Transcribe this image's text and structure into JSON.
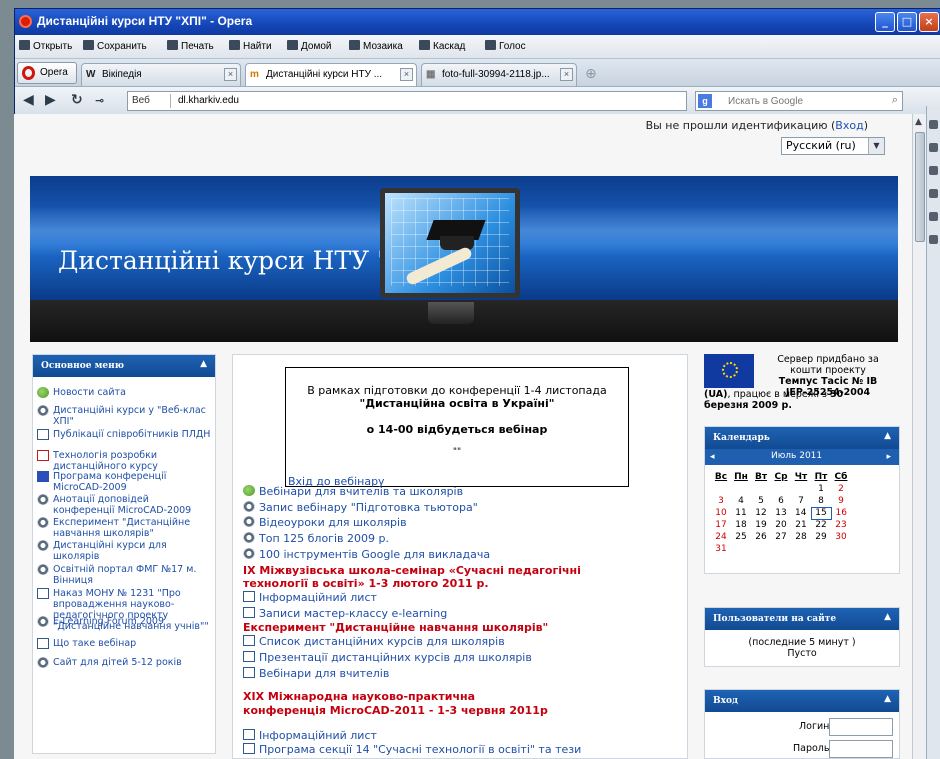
{
  "window": {
    "title": "Дистанційні курси НТУ \"ХПІ\" - Opera"
  },
  "menubar": [
    {
      "label": "Открыть"
    },
    {
      "label": "Сохранить"
    },
    {
      "label": "Печать"
    },
    {
      "label": "Найти"
    },
    {
      "label": "Домой"
    },
    {
      "label": "Мозаика"
    },
    {
      "label": "Каскад"
    },
    {
      "label": "Голос"
    }
  ],
  "tabs": {
    "opera_button": "Opera",
    "items": [
      {
        "label": "Вікіпедія"
      },
      {
        "label": "Дистанційні курси НТУ ..."
      },
      {
        "label": "foto-full-30994-2118.jp..."
      }
    ]
  },
  "navbar": {
    "web_label": "Веб",
    "url": "dl.kharkiv.edu",
    "search_placeholder": "Искать в Google"
  },
  "page": {
    "login_status": "Вы не прошли идентификацию (",
    "login_link": "Вход",
    "login_close": ")",
    "language": "Русский (ru)",
    "banner_title": "Дистанційні курси НТУ \"ХПІ\""
  },
  "left_menu": {
    "title": "Основное меню",
    "items": [
      {
        "label": "Новости сайта",
        "icon": "news-icon"
      },
      {
        "label": "Дистанційні курси у \"Веб-клас ХПІ\"",
        "icon": "moodle-icon"
      },
      {
        "label": "Публікації співробітників ПЛДН",
        "icon": "page-icon"
      },
      {
        "label": "Технологія розробки дистанційного курсу",
        "icon": "pdf-icon"
      },
      {
        "label": "Програма конференції MicroCAD-2009",
        "icon": "word-icon"
      },
      {
        "label": "Анотації доповідей конференції MicroCAD-2009",
        "icon": "moodle-icon"
      },
      {
        "label": "Експеримент \"Дистанційне навчання школярів\"",
        "icon": "moodle-icon"
      },
      {
        "label": "Дистанційні курси для школярів",
        "icon": "moodle-icon"
      },
      {
        "label": "Освітній портал ФМГ №17 м. Вінниця",
        "icon": "moodle-icon"
      },
      {
        "label": "Наказ МОНУ № 1231 \"Про впровадження науково-педагогічного проекту \"Дистанційне навчання учнів\"\"",
        "icon": "page-icon"
      },
      {
        "label": "E-Learning Forum 2009",
        "icon": "moodle-icon"
      },
      {
        "label": "Що таке вебінар",
        "icon": "page-icon"
      },
      {
        "label": "Сайт для дітей 5-12 років",
        "icon": "moodle-icon"
      }
    ]
  },
  "center": {
    "notice": {
      "line1": "В рамках підготовки до конференції 1-4 листопада",
      "line2": "\"Дистанційна освіта в Україні\"",
      "line3": "о 14-00 відбудеться вебінар",
      "line4": "\"\"",
      "link": "Вхід до вебінару"
    },
    "links1": [
      {
        "label": "Вебінари для вчителів та школярів",
        "icon": "news-icon"
      },
      {
        "label": "Запис вебінару \"Підготовка тьютора\"",
        "icon": "moodle-icon"
      },
      {
        "label": "Відеоуроки для школярів",
        "icon": "moodle-icon"
      },
      {
        "label": "Топ 125 блогів 2009 р.",
        "icon": "moodle-icon"
      },
      {
        "label": "100 інструментів Google для викладача",
        "icon": "moodle-icon"
      }
    ],
    "heading1_line1": "IX Міжвузівська школа-семінар «Сучасні педагогічні",
    "heading1_line2": "технології в освіті» 1-3 лютого 2011 р.",
    "links2": [
      {
        "label": "Інформаційний лист"
      },
      {
        "label": "Записи мастер-классу e-learning"
      }
    ],
    "heading2": "Експеримент \"Дистанційне навчання школярів\"",
    "links3": [
      {
        "label": "Список дистанційних курсів для школярів"
      },
      {
        "label": "Презентації дистанційних курсів для школярів"
      },
      {
        "label": "Вебінари для вчителів"
      }
    ],
    "heading3_line1": "XIX Міжнародна науково-практична",
    "heading3_line2": "конференція MicroCAD-2011 - 1-3 червня 2011р",
    "links4": [
      {
        "label": "Інформаційний лист"
      },
      {
        "label": "Програма секції 14 \"Сучасні технології в освіті\" та тези"
      }
    ]
  },
  "right": {
    "eu_text_l1": "Сервер придбано за",
    "eu_text_l2": "кошти проекту",
    "eu_text_l3": "Темпус Тасіс № IB",
    "eu_text_l4": "JEP-25254-2004",
    "eu_text_l5_a": "(UA)",
    "eu_text_l5_b": ", працює в мережі з ",
    "eu_text_l5_c": "30",
    "eu_text_l6": "березня 2009 р.",
    "calendar": {
      "title": "Календарь",
      "month": "Июль 2011",
      "prev": "◂",
      "next": "▸",
      "days": [
        "Вс",
        "Пн",
        "Вт",
        "Ср",
        "Чт",
        "Пт",
        "Сб"
      ],
      "weeks": [
        [
          "",
          "",
          "",
          "",
          "",
          "1",
          "2"
        ],
        [
          "3",
          "4",
          "5",
          "6",
          "7",
          "8",
          "9"
        ],
        [
          "10",
          "11",
          "12",
          "13",
          "14",
          "15",
          "16"
        ],
        [
          "17",
          "18",
          "19",
          "20",
          "21",
          "22",
          "23"
        ],
        [
          "24",
          "25",
          "26",
          "27",
          "28",
          "29",
          "30"
        ],
        [
          "31",
          "",
          "",
          "",
          "",
          "",
          ""
        ]
      ],
      "today": "15"
    },
    "users": {
      "title": "Пользователи на сайте",
      "line1": "(последние 5 минут )",
      "line2": "Пусто"
    },
    "login": {
      "title": "Вход",
      "username_label": "Логин",
      "password_label": "Пароль"
    }
  },
  "colors": {
    "title_bar": "#1546b8",
    "block_header": "#1e63b4",
    "link": "#1f4fa8",
    "heading_red": "#c3000e"
  }
}
